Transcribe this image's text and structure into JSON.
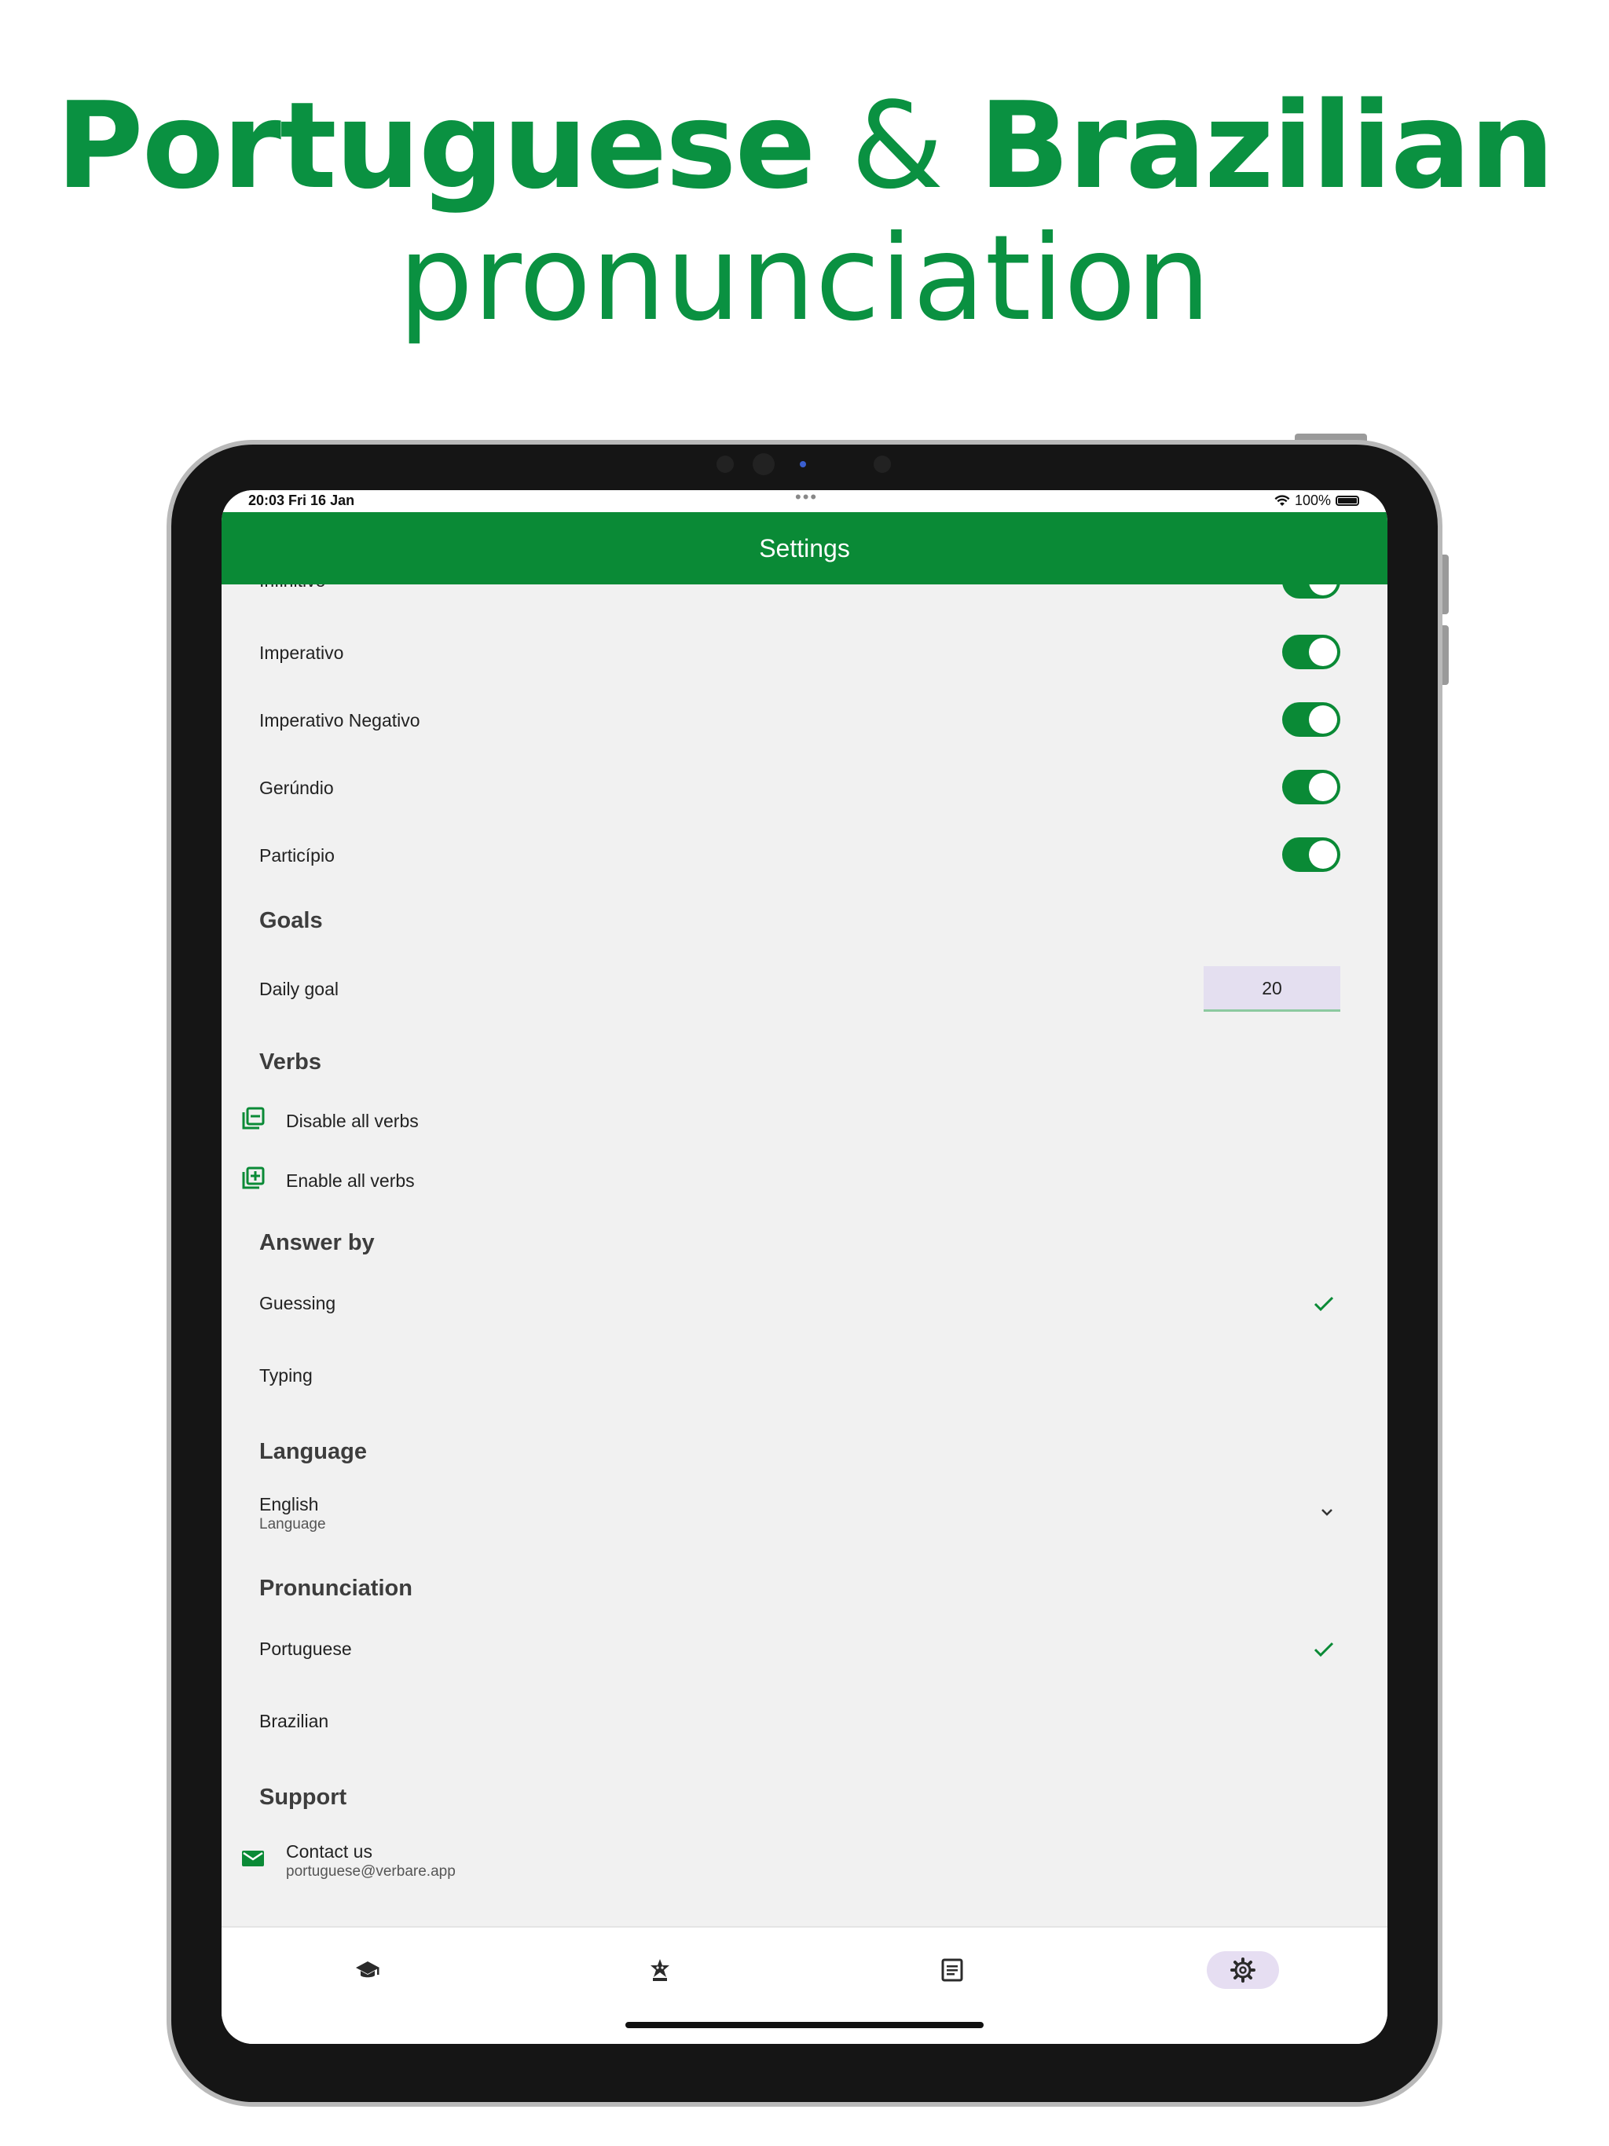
{
  "headline": {
    "word1": "Portuguese",
    "amp": "&",
    "word2": "Brazilian",
    "line2": "pronunciation"
  },
  "status": {
    "time": "20:03  Fri 16 Jan",
    "dots": "•••",
    "battery": "100%"
  },
  "appbar": {
    "title": "Settings"
  },
  "tenses": [
    {
      "label": "Infinitivo",
      "on": true
    },
    {
      "label": "Imperativo",
      "on": true
    },
    {
      "label": "Imperativo Negativo",
      "on": true
    },
    {
      "label": "Gerúndio",
      "on": true
    },
    {
      "label": "Particípio",
      "on": true
    }
  ],
  "goals": {
    "title": "Goals",
    "daily_label": "Daily goal",
    "daily_value": "20"
  },
  "verbs": {
    "title": "Verbs",
    "disable_label": "Disable all verbs",
    "enable_label": "Enable all verbs"
  },
  "answer_by": {
    "title": "Answer by",
    "option1": "Guessing",
    "option2": "Typing",
    "selected": "Guessing"
  },
  "language": {
    "title": "Language",
    "value": "English",
    "sublabel": "Language"
  },
  "pronunciation": {
    "title": "Pronunciation",
    "option1": "Portuguese",
    "option2": "Brazilian",
    "selected": "Portuguese"
  },
  "support": {
    "title": "Support",
    "contact_label": "Contact us",
    "contact_email": "portuguese@verbare.app"
  },
  "bottom_nav": [
    {
      "icon": "school-icon",
      "active": false
    },
    {
      "icon": "star-badge-icon",
      "active": false
    },
    {
      "icon": "article-icon",
      "active": false
    },
    {
      "icon": "settings-gear-icon",
      "active": true
    }
  ],
  "colors": {
    "brand_green": "#0a8a36",
    "headline_green": "#0a9141",
    "active_nav_bg": "#e6def2"
  }
}
